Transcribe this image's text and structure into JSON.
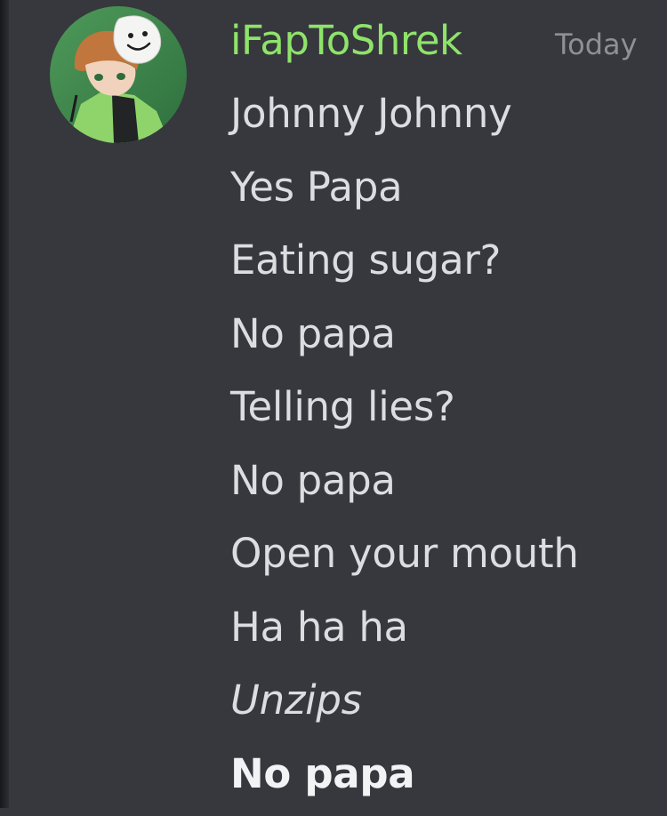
{
  "message": {
    "username": "iFapToShrek",
    "timestamp": "Today",
    "username_color": "#8fe36a",
    "background_color": "#36383d",
    "avatar": "avatar-image",
    "lines": [
      {
        "text": "Johnny Johnny",
        "style": "normal"
      },
      {
        "text": "Yes Papa",
        "style": "normal"
      },
      {
        "text": "Eating sugar?",
        "style": "normal"
      },
      {
        "text": "No papa",
        "style": "normal"
      },
      {
        "text": "Telling lies?",
        "style": "normal"
      },
      {
        "text": "No papa",
        "style": "normal"
      },
      {
        "text": "Open your mouth",
        "style": "normal"
      },
      {
        "text": "Ha ha ha",
        "style": "normal"
      },
      {
        "text": "Unzips",
        "style": "italic"
      },
      {
        "text": "No papa",
        "style": "bold"
      }
    ]
  }
}
